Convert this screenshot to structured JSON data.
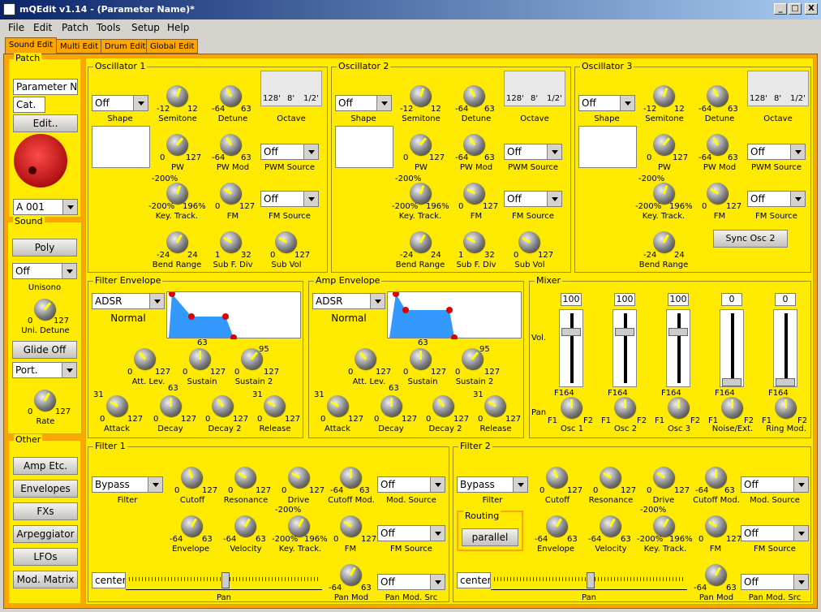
{
  "window": {
    "title": "mQEdit v1.14 - (Parameter Name)*",
    "min": "_",
    "max": "□",
    "close": "X"
  },
  "menu": [
    "File",
    "Edit",
    "Patch",
    "Tools",
    "Setup",
    "Help"
  ],
  "tabs": [
    "Sound Edit",
    "Multi Edit",
    "Drum Edit",
    "Global Edit"
  ],
  "patch": {
    "label": "Patch",
    "name": "Parameter Na",
    "cat": "Cat.",
    "edit": "Edit..",
    "slot": "A 001"
  },
  "sound": {
    "label": "Sound",
    "poly": "Poly",
    "unisono_val": "Off",
    "unisono": "Unisono",
    "uni_min": "0",
    "uni_max": "127",
    "uni_detune": "Uni. Detune",
    "glide": "Glide Off",
    "port": "Port.",
    "rate_min": "0",
    "rate_max": "127",
    "rate": "Rate"
  },
  "other": {
    "label": "Other",
    "buttons": [
      "Amp Etc.",
      "Envelopes",
      "FXs",
      "Arpeggiator",
      "LFOs",
      "Mod. Matrix"
    ]
  },
  "osc": {
    "titles": [
      "Oscillator 1",
      "Oscillator 2",
      "Oscillator 3"
    ],
    "shape_val": "Off",
    "shape": "Shape",
    "semi_min": "-12",
    "semi_max": "12",
    "semitone": "Semitone",
    "det_min": "-64",
    "det_max": "63",
    "detune": "Detune",
    "oct_ticks": [
      "128'",
      "8'",
      "1/2'"
    ],
    "octave": "Octave",
    "pw_min": "0",
    "pw_max": "127",
    "pw": "PW",
    "pwm_min": "-64",
    "pwm_max": "63",
    "pwmod": "PW Mod",
    "pwms_val": "Off",
    "pwmsource": "PWM Source",
    "kt_top": "-200%",
    "kt_min": "-200%",
    "kt_max": "196%",
    "keytrack": "Key. Track.",
    "fm_min": "0",
    "fm_max": "127",
    "fm": "FM",
    "fms_val": "Off",
    "fmsource": "FM Source",
    "bend_min": "-24",
    "bend_max": "24",
    "bend": "Bend Range",
    "sub_min": "1",
    "sub_max": "32",
    "subdiv": "Sub F. Div",
    "subv_min": "0",
    "subv_max": "127",
    "subvol": "Sub Vol",
    "sync": "Sync Osc 2"
  },
  "fenv": {
    "title": "Filter Envelope",
    "mode": "ADSR",
    "trig": "Normal"
  },
  "aenv": {
    "title": "Amp Envelope",
    "mode": "ADSR",
    "trig": "Normal"
  },
  "envk": {
    "z": "0",
    "m": "127",
    "s63": "63",
    "s95": "95",
    "s31": "31",
    "attlev": "Att. Lev.",
    "sustain": "Sustain",
    "sustain2": "Sustain 2",
    "attack": "Attack",
    "decay": "Decay",
    "decay2": "Decay 2",
    "release": "Release"
  },
  "mixer": {
    "title": "Mixer",
    "vol": "Vol.",
    "pan": "Pan",
    "values": [
      "100",
      "100",
      "100",
      "0",
      "0"
    ],
    "f1": "F1",
    "f2": "F2",
    "c64": "64",
    "channels": [
      "Osc 1",
      "Osc 2",
      "Osc 3",
      "Noise/Ext.",
      "Ring Mod."
    ],
    "levels": [
      0.78,
      0.78,
      0.78,
      0,
      0
    ]
  },
  "filter": {
    "titles": [
      "Filter 1",
      "Filter 2"
    ],
    "type": "Bypass",
    "filter": "Filter",
    "z": "0",
    "m": "127",
    "n64": "-64",
    "p63": "63",
    "kt_top": "-200%",
    "kt_min": "-200%",
    "kt_max": "196%",
    "cutoff": "Cutoff",
    "resonance": "Resonance",
    "drive": "Drive",
    "cutoffmod": "Cutoff Mod.",
    "modsrc_val": "Off",
    "modsrc": "Mod. Source",
    "envelope": "Envelope",
    "velocity": "Velocity",
    "keytrack": "Key. Track.",
    "fm": "FM",
    "fmsrc_val": "Off",
    "fmsrc": "FM Source",
    "pan_val": "center",
    "pan": "Pan",
    "panmod": "Pan Mod",
    "pms_val": "Off",
    "panmodsrc": "Pan Mod. Src",
    "routing": "Routing",
    "parallel": "parallel"
  }
}
